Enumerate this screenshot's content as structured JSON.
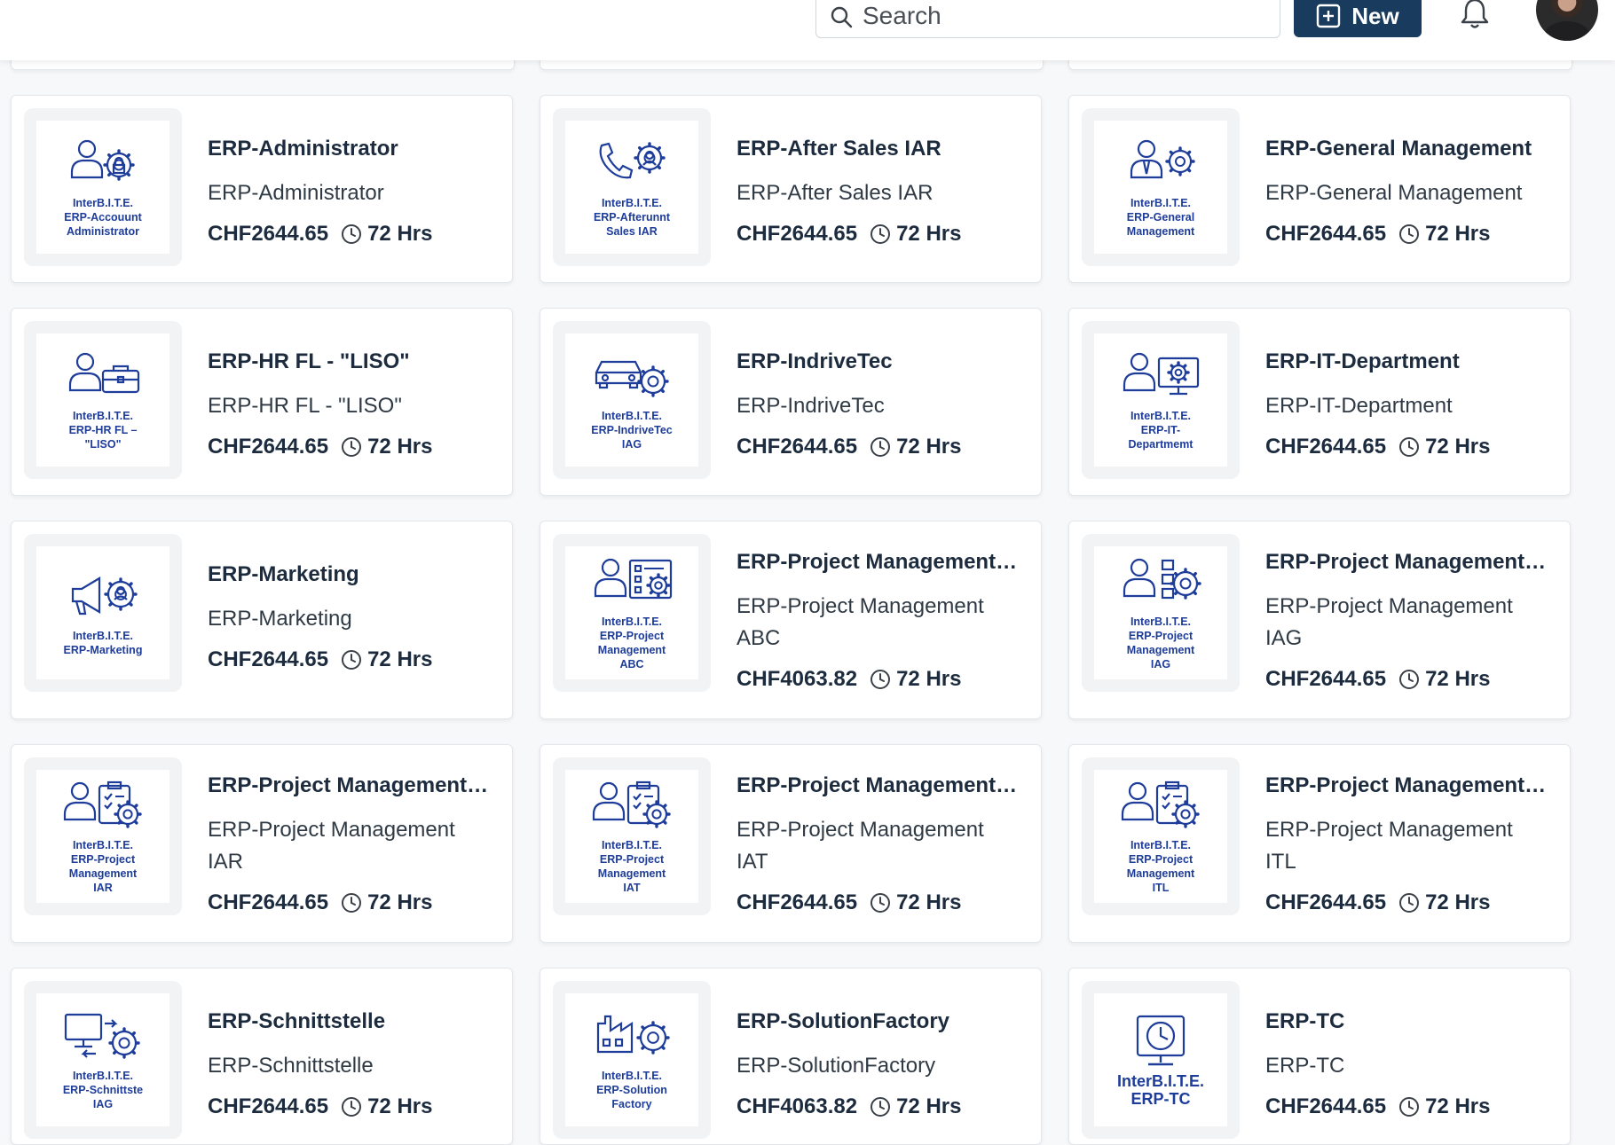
{
  "header": {
    "search_placeholder": "Search",
    "new_label": "New"
  },
  "cards": [
    {
      "title": "ERP-Administrator",
      "subtitle": "ERP-Administrator",
      "price": "CHF2644.65",
      "duration": "72 Hrs",
      "icon": "user-lock-gear-icon",
      "caption": [
        "InterB.I.T.E.",
        "ERP-Accouunt",
        "Administrator"
      ]
    },
    {
      "title": "ERP-After Sales IAR",
      "subtitle": "ERP-After Sales IAR",
      "price": "CHF2644.65",
      "duration": "72 Hrs",
      "icon": "phone-user-gear-icon",
      "caption": [
        "InterB.I.T.E.",
        "ERP-Afterunnt",
        "Sales IAR"
      ]
    },
    {
      "title": "ERP-General Management",
      "subtitle": "ERP-General Management",
      "price": "CHF2644.65",
      "duration": "72 Hrs",
      "icon": "manager-gear-icon",
      "caption": [
        "InterB.I.T.E.",
        "ERP-General",
        "Management"
      ]
    },
    {
      "title": "ERP-HR FL - \"LISO\"",
      "subtitle": "ERP-HR FL - \"LISO\"",
      "price": "CHF2644.65",
      "duration": "72 Hrs",
      "icon": "user-briefcase-icon",
      "caption": [
        "InterB.I.T.E.",
        "ERP-HR FL –",
        "\"LISO\""
      ]
    },
    {
      "title": "ERP-IndriveTec",
      "subtitle": "ERP-IndriveTec",
      "price": "CHF2644.65",
      "duration": "72 Hrs",
      "icon": "car-gear-icon",
      "caption": [
        "InterB.I.T.E.",
        "ERP-IndriveTec",
        "IAG"
      ]
    },
    {
      "title": "ERP-IT-Department",
      "subtitle": "ERP-IT-Department",
      "price": "CHF2644.65",
      "duration": "72 Hrs",
      "icon": "user-monitor-gear-icon",
      "caption": [
        "InterB.I.T.E.",
        "ERP-IT-",
        "Departmemt"
      ]
    },
    {
      "title": "ERP-Marketing",
      "subtitle": "ERP-Marketing",
      "price": "CHF2644.65",
      "duration": "72 Hrs",
      "icon": "megaphone-gear-icon",
      "caption": [
        "InterB.I.T.E.",
        "ERP-Marketing"
      ]
    },
    {
      "title": "ERP-Project Management…",
      "subtitle": "ERP-Project Management ABC",
      "price": "CHF4063.82",
      "duration": "72 Hrs",
      "icon": "user-board-gear-icon",
      "caption": [
        "InterB.I.T.E.",
        "ERP-Project",
        "Management",
        "ABC"
      ]
    },
    {
      "title": "ERP-Project Management…",
      "subtitle": "ERP-Project Management IAG",
      "price": "CHF2644.65",
      "duration": "72 Hrs",
      "icon": "user-org-gear-icon",
      "caption": [
        "InterB.I.T.E.",
        "ERP-Project",
        "Management",
        "IAG"
      ]
    },
    {
      "title": "ERP-Project Management…",
      "subtitle": "ERP-Project Management IAR",
      "price": "CHF2644.65",
      "duration": "72 Hrs",
      "icon": "user-clipboard-gear-icon",
      "caption": [
        "InterB.I.T.E.",
        "ERP-Project",
        "Management",
        "IAR"
      ]
    },
    {
      "title": "ERP-Project Management…",
      "subtitle": "ERP-Project Management IAT",
      "price": "CHF2644.65",
      "duration": "72 Hrs",
      "icon": "user-clipboard-gear-icon",
      "caption": [
        "InterB.I.T.E.",
        "ERP-Project",
        "Management",
        "IAT"
      ]
    },
    {
      "title": "ERP-Project Management…",
      "subtitle": "ERP-Project Management ITL",
      "price": "CHF2644.65",
      "duration": "72 Hrs",
      "icon": "user-clipboard-gear-icon",
      "caption": [
        "InterB.I.T.E.",
        "ERP-Project",
        "Management",
        "ITL"
      ]
    },
    {
      "title": "ERP-Schnittstelle",
      "subtitle": "ERP-Schnittstelle",
      "price": "CHF2644.65",
      "duration": "72 Hrs",
      "icon": "monitor-sync-gear-icon",
      "caption": [
        "InterB.I.T.E.",
        "ERP-Schnittste",
        "IAG"
      ]
    },
    {
      "title": "ERP-SolutionFactory",
      "subtitle": "ERP-SolutionFactory",
      "price": "CHF4063.82",
      "duration": "72 Hrs",
      "icon": "factory-gear-icon",
      "caption": [
        "InterB.I.T.E.",
        "ERP-Solution",
        "Factory"
      ]
    },
    {
      "title": "ERP-TC",
      "subtitle": "ERP-TC",
      "price": "CHF2644.65",
      "duration": "72 Hrs",
      "icon": "monitor-clock-icon",
      "caption": [
        "InterB.I.T.E.",
        "ERP-TC"
      ]
    }
  ]
}
